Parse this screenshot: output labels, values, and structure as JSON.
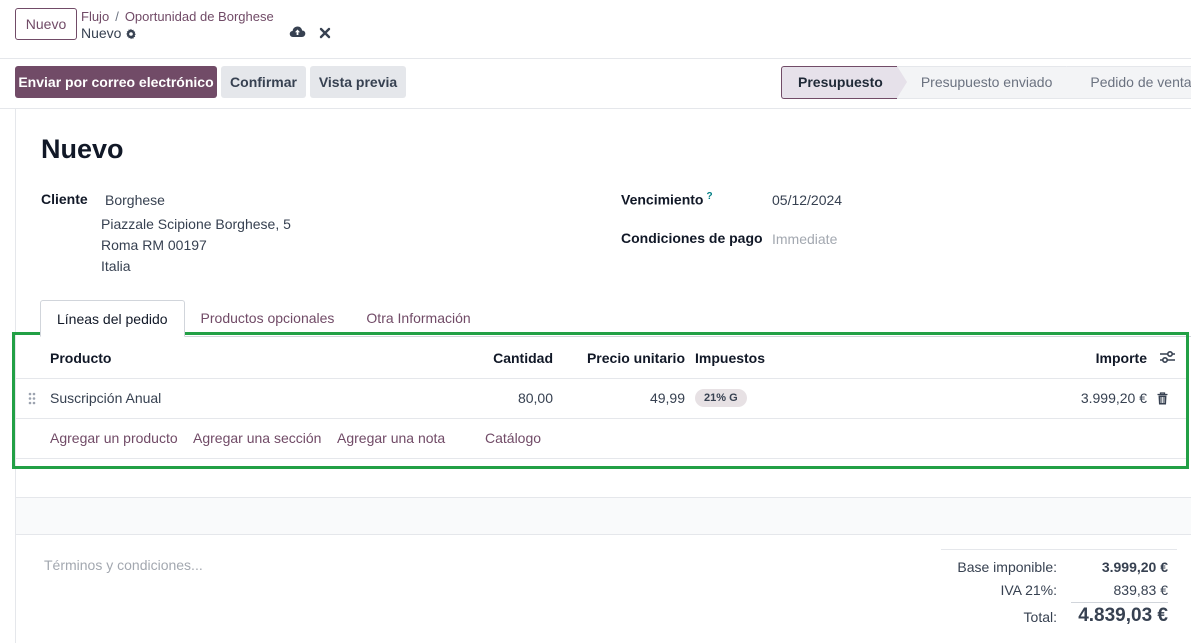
{
  "control_panel": {
    "new_button": "Nuevo",
    "breadcrumb": [
      "Flujo",
      "Oportunidad de Borghese"
    ],
    "breadcrumb_separator": "/",
    "record_name": "Nuevo",
    "icons": [
      "gear-icon",
      "cloud-upload-icon",
      "close-icon"
    ]
  },
  "actions": {
    "send_email": "Enviar por correo electrónico",
    "confirm": "Confirmar",
    "preview": "Vista previa"
  },
  "statusbar": {
    "stages": [
      "Presupuesto",
      "Presupuesto enviado",
      "Pedido de venta"
    ],
    "active_stage": "Presupuesto"
  },
  "form": {
    "title": "Nuevo",
    "customer_label": "Cliente",
    "customer_name": "Borghese",
    "customer_address": [
      "Piazzale Scipione Borghese, 5",
      "Roma RM 00197",
      "Italia"
    ],
    "expiration_label": "Vencimiento",
    "expiration_help": "?",
    "expiration_value": "05/12/2024",
    "payment_terms_label": "Condiciones de pago",
    "payment_terms_placeholder": "Immediate"
  },
  "tabs": [
    "Líneas del pedido",
    "Productos opcionales",
    "Otra Información"
  ],
  "order_lines": {
    "columns": {
      "product": "Producto",
      "quantity": "Cantidad",
      "unit_price": "Precio unitario",
      "taxes": "Impuestos",
      "amount": "Importe"
    },
    "rows": [
      {
        "product": "Suscripción Anual",
        "quantity": "80,00",
        "unit_price": "49,99",
        "tax_badge": "21% G",
        "amount": "3.999,20 €"
      }
    ],
    "add_links": [
      "Agregar un producto",
      "Agregar una sección",
      "Agregar una nota",
      "Catálogo"
    ],
    "highlight_color": "#22a045"
  },
  "footer": {
    "terms_placeholder": "Términos y condiciones...",
    "totals": {
      "base_label": "Base imponible:",
      "base_value": "3.999,20 €",
      "tax_label": "IVA 21%:",
      "tax_value": "839,83 €",
      "total_label": "Total:",
      "total_value": "4.839,03 €"
    }
  },
  "colors": {
    "brand": "#714b67",
    "active_stage_bg": "#e6e1ea",
    "link": "#714b67"
  }
}
